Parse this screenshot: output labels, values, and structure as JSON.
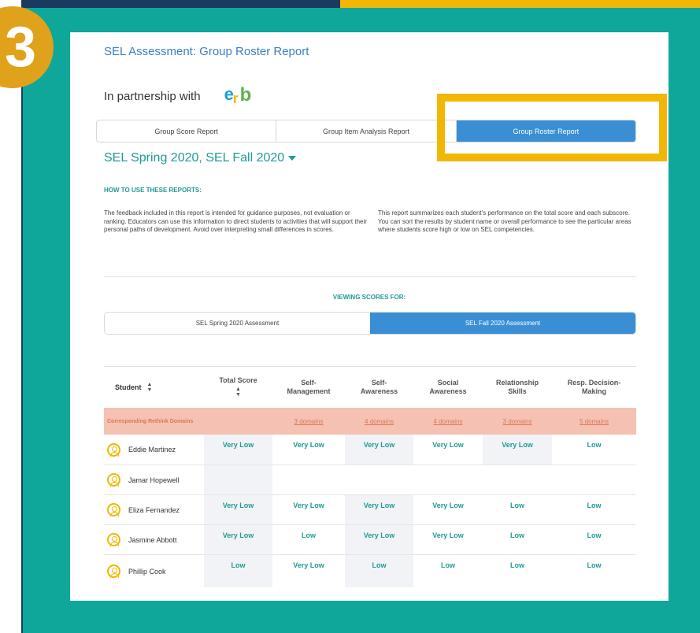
{
  "step_number": "3",
  "report": {
    "title": "SEL Assessment: Group Roster Report",
    "partner_text": "In partnership with",
    "partner_logo": "erb-logo"
  },
  "tabs": [
    {
      "label": "Group Score Report",
      "active": false
    },
    {
      "label": "Group Item Analysis Report",
      "active": false
    },
    {
      "label": "Group Roster Report",
      "active": true
    }
  ],
  "assessment_selector": "SEL Spring 2020, SEL Fall 2020",
  "howto": {
    "heading": "HOW TO USE THESE REPORTS:",
    "left_text": "The feedback included in this report is intended for guidance purposes, not evaluation or ranking. Educators can use this information to direct students to activities that will support their personal paths of development. Avoid over interpreting small differences in scores.",
    "right_text": "This report summarizes each student's performance on the total score and each subscore. You can sort the results by student name or overall performance to see the particular areas where students score high or low on SEL competencies."
  },
  "viewing": {
    "label": "VIEWING SCORES FOR:",
    "options": [
      {
        "label": "SEL Spring 2020 Assessment",
        "active": false
      },
      {
        "label": "SEL Fall 2020 Assessment",
        "active": true
      }
    ]
  },
  "table": {
    "headers": {
      "student": "Student",
      "total": "Total Score",
      "self_management": "Self-\nManagement",
      "self_awareness": "Self-\nAwareness",
      "social_awareness": "Social\nAwareness",
      "relationship": "Relationship\nSkills",
      "decision": "Resp. Decision-\nMaking"
    },
    "domains_label": "Corresponding Rethink Domains",
    "domains": [
      "3 domains",
      "4 domains",
      "4 domains",
      "3 domains",
      "5 domains"
    ],
    "rows": [
      {
        "name": "Eddie Martinez",
        "scores": [
          "Very Low",
          "Very Low",
          "Very Low",
          "Very Low",
          "Very Low",
          "Low"
        ]
      },
      {
        "name": "Jamar Hopewell",
        "scores": [
          "",
          "",
          "",
          "",
          "",
          ""
        ]
      },
      {
        "name": "Eliza Fernandez",
        "scores": [
          "Very Low",
          "Very Low",
          "Very Low",
          "Very Low",
          "Low",
          "Low"
        ]
      },
      {
        "name": "Jasmine Abbott",
        "scores": [
          "Very Low",
          "Low",
          "Very Low",
          "Very Low",
          "Low",
          "Low"
        ]
      },
      {
        "name": "Phillip Cook",
        "scores": [
          "Low",
          "Very Low",
          "Low",
          "Low",
          "Low",
          "Low"
        ]
      }
    ]
  },
  "colors": {
    "teal_frame": "#0ea79a",
    "navy": "#1a3a5f",
    "highlight_yellow": "#f2b705",
    "badge_orange": "#e0a11b",
    "active_blue": "#3a8fd4",
    "domains_bg": "#f5c1b2"
  }
}
